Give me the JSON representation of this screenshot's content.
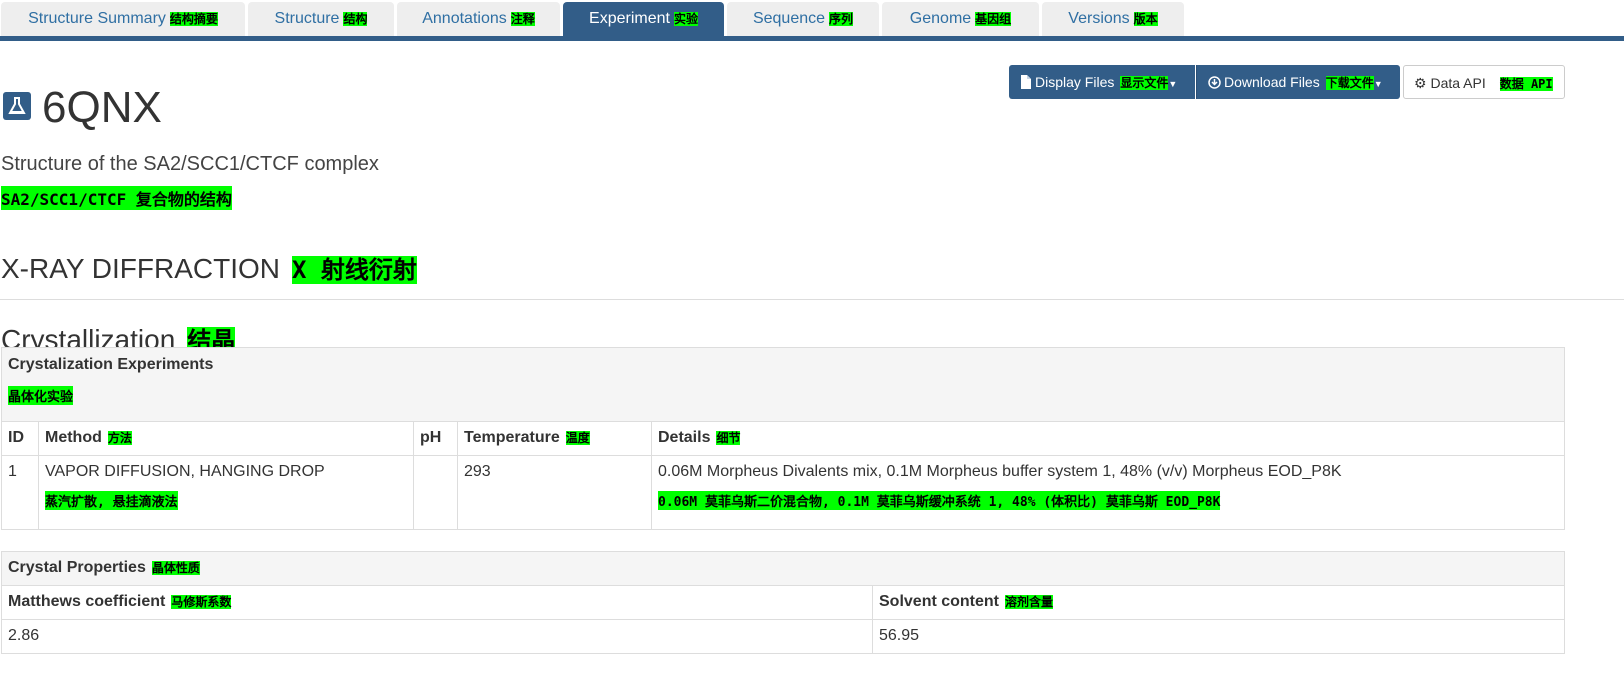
{
  "tabs": [
    {
      "label": "Structure Summary",
      "tr": "结构摘要"
    },
    {
      "label": "Structure",
      "tr": "结构"
    },
    {
      "label": "Annotations",
      "tr": "注释"
    },
    {
      "label": "Experiment",
      "tr": "实验",
      "active": true
    },
    {
      "label": "Sequence",
      "tr": "序列"
    },
    {
      "label": "Genome",
      "tr": "基因组"
    },
    {
      "label": "Versions",
      "tr": "版本"
    }
  ],
  "toolbar": {
    "display_files": "Display Files",
    "display_files_tr": "显示文件",
    "download_files": "Download Files",
    "download_files_tr": "下载文件",
    "data_api": "Data API",
    "data_api_tr": "数据 API"
  },
  "header": {
    "icon": "flask-icon",
    "pdb_id": "6QNX",
    "title": "Structure of the SA2/SCC1/CTCF complex",
    "title_tr": "SA2/SCC1/CTCF 复合物的结构",
    "method": "X-RAY DIFFRACTION",
    "method_tr": "X 射线衍射"
  },
  "crystallization": {
    "heading": "Crystallization",
    "heading_tr": "结晶",
    "experiments": {
      "caption": "Crystalization Experiments",
      "caption_tr": "晶体化实验",
      "columns": [
        {
          "label": "ID",
          "tr": ""
        },
        {
          "label": "Method",
          "tr": "方法"
        },
        {
          "label": "pH",
          "tr": ""
        },
        {
          "label": "Temperature",
          "tr": "温度"
        },
        {
          "label": "Details",
          "tr": "细节"
        }
      ],
      "rows": [
        {
          "id": "1",
          "method": "VAPOR DIFFUSION, HANGING DROP",
          "method_tr": "蒸汽扩散, 悬挂滴液法",
          "ph": "",
          "temperature": "293",
          "details": "0.06M Morpheus Divalents mix, 0.1M Morpheus buffer system 1, 48% (v/v) Morpheus EOD_P8K",
          "details_tr": "0.06M 莫菲乌斯二价混合物, 0.1M 莫菲乌斯缓冲系统 1, 48% (体积比) 莫菲乌斯 EOD_P8K"
        }
      ]
    },
    "properties": {
      "caption": "Crystal Properties",
      "caption_tr": "晶体性质",
      "matthews_label": "Matthews coefficient",
      "matthews_tr": "马修斯系数",
      "solvent_label": "Solvent content",
      "solvent_tr": "溶剂含量",
      "matthews": "2.86",
      "solvent": "56.95"
    }
  },
  "colors": {
    "brand": "#325d88",
    "highlight": "#00ff00"
  }
}
